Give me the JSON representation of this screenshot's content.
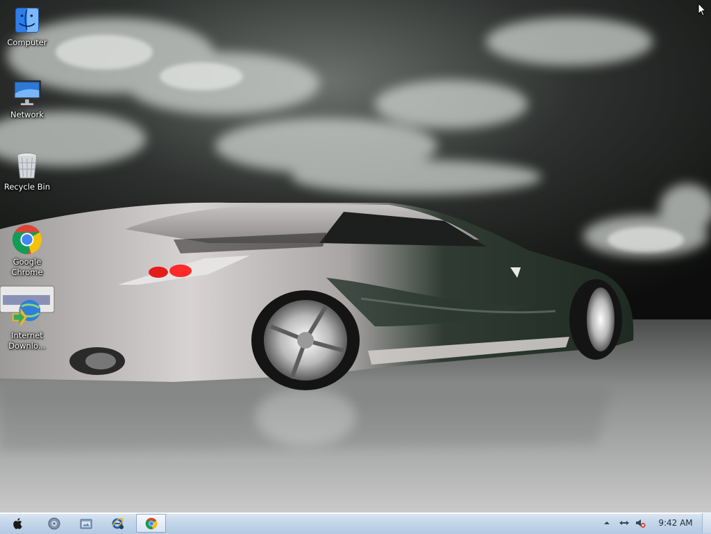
{
  "desktop": {
    "icons": [
      {
        "label": "Computer"
      },
      {
        "label": "Network"
      },
      {
        "label": "Recycle Bin"
      },
      {
        "label": "Google Chrome"
      },
      {
        "label": "Internet Downlo..."
      }
    ]
  },
  "taskbar": {
    "buttons": [
      {
        "icon": "apple-icon"
      },
      {
        "icon": "media-player-icon"
      },
      {
        "icon": "file-explorer-icon"
      },
      {
        "icon": "internet-explorer-icon"
      },
      {
        "icon": "chrome-icon",
        "active": true
      }
    ],
    "tray": {
      "icons": [
        "show-hidden-icons-icon",
        "network-icon",
        "volume-muted-icon"
      ],
      "clock": "9:42 AM"
    }
  },
  "colors": {
    "taskbar": "#c4d6ea",
    "chrome_red": "#db4437",
    "chrome_yellow": "#f4c20d",
    "chrome_green": "#0f9d58",
    "chrome_blue": "#4285f4"
  }
}
